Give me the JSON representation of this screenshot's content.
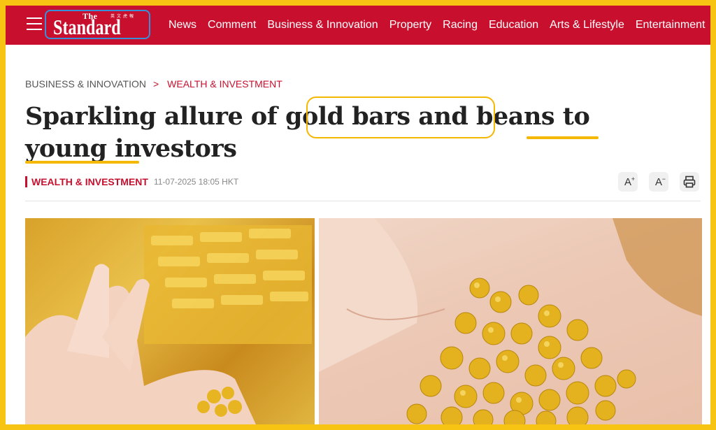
{
  "header": {
    "logo": {
      "the": "The",
      "main": "Standard",
      "chinese": "英文虎報"
    },
    "nav": [
      "News",
      "Comment",
      "Business & Innovation",
      "Property",
      "Racing",
      "Education",
      "Arts & Lifestyle",
      "Entertainment"
    ]
  },
  "breadcrumb": {
    "first": "BUSINESS & INNOVATION",
    "separator": ">",
    "second": "WEALTH & INVESTMENT"
  },
  "article": {
    "title": "Sparkling allure of gold bars and beans to young investors",
    "category": "WEALTH & INVESTMENT",
    "date": "11-07-2025 18:05 HKT"
  },
  "tools": {
    "increase_font": "A+",
    "decrease_font": "A−",
    "print": "print-icon"
  },
  "colors": {
    "brand_red": "#c8102e",
    "highlight_yellow": "#f5b800",
    "frame_yellow": "#f7c414",
    "logo_outline_blue": "#3a8fd9"
  },
  "images": [
    "gold-bars-and-hand-photo",
    "gold-beans-in-palm-photo"
  ]
}
